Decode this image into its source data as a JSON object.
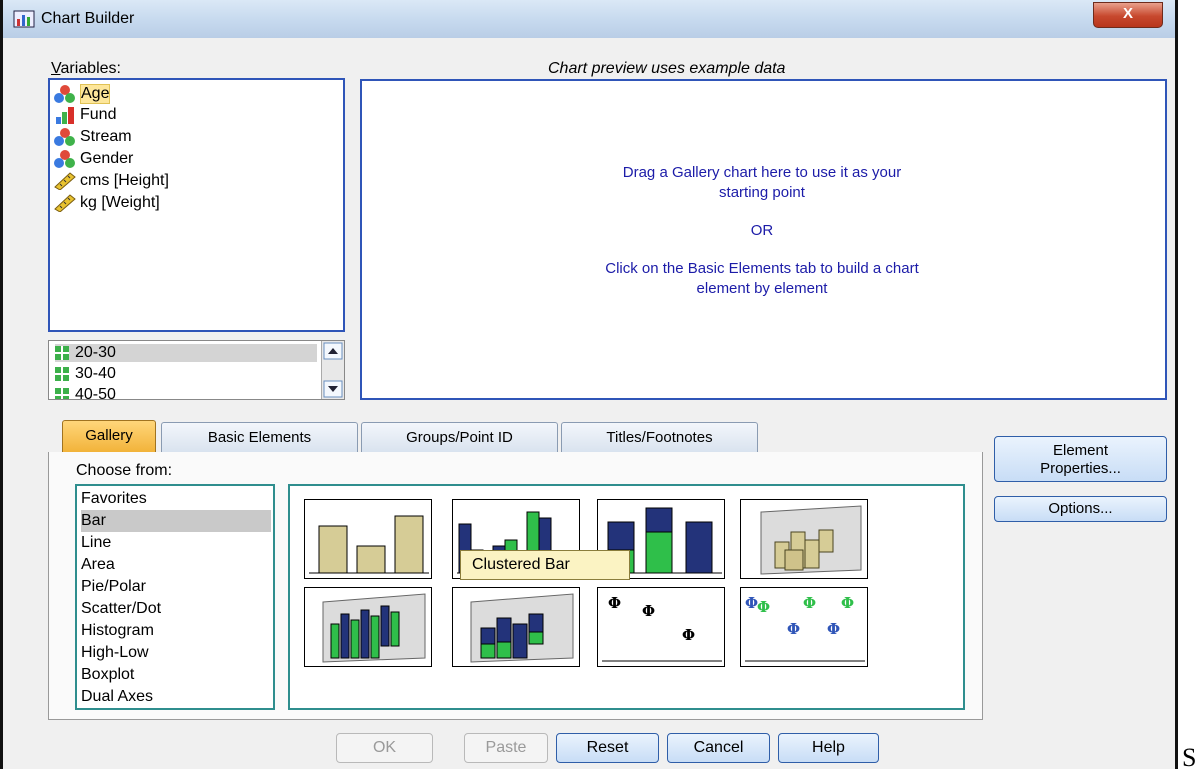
{
  "window": {
    "title": "Chart Builder",
    "close": "X"
  },
  "variables": {
    "label": "Variables:",
    "items": [
      {
        "name": "Age",
        "icon": "nominal-icon"
      },
      {
        "name": "Fund",
        "icon": "scale-bar-icon"
      },
      {
        "name": "Stream",
        "icon": "nominal-icon"
      },
      {
        "name": "Gender",
        "icon": "nominal-icon"
      },
      {
        "name": "cms [Height]",
        "icon": "ruler-icon"
      },
      {
        "name": "kg [Weight]",
        "icon": "ruler-icon"
      }
    ]
  },
  "categories": {
    "items": [
      "20-30",
      "30-40",
      "40-50"
    ]
  },
  "preview": {
    "header": "Chart preview uses example data",
    "line1": "Drag a Gallery chart here to use it as your",
    "line2": "starting point",
    "or": "OR",
    "line3": "Click on the Basic Elements tab to build a chart",
    "line4": "element by element"
  },
  "tabs": [
    "Gallery",
    "Basic Elements",
    "Groups/Point ID",
    "Titles/Footnotes"
  ],
  "gallery": {
    "choose_label": "Choose from:",
    "types": [
      "Favorites",
      "Bar",
      "Line",
      "Area",
      "Pie/Polar",
      "Scatter/Dot",
      "Histogram",
      "High-Low",
      "Boxplot",
      "Dual Axes"
    ],
    "selected": "Bar",
    "tooltip": "Clustered Bar"
  },
  "side_buttons": {
    "element_line1": "Element",
    "element_line2": "Properties...",
    "options": "Options..."
  },
  "buttons": {
    "ok": "OK",
    "paste": "Paste",
    "reset": "Reset",
    "cancel": "Cancel",
    "help": "Help"
  },
  "edge_text": "S",
  "colors": {
    "accent": "#2f55b8",
    "bar_tan": "#d6cc96",
    "bar_navy": "#23337a",
    "bar_green": "#2fbf4a",
    "preview_text": "#1c1ca8"
  }
}
